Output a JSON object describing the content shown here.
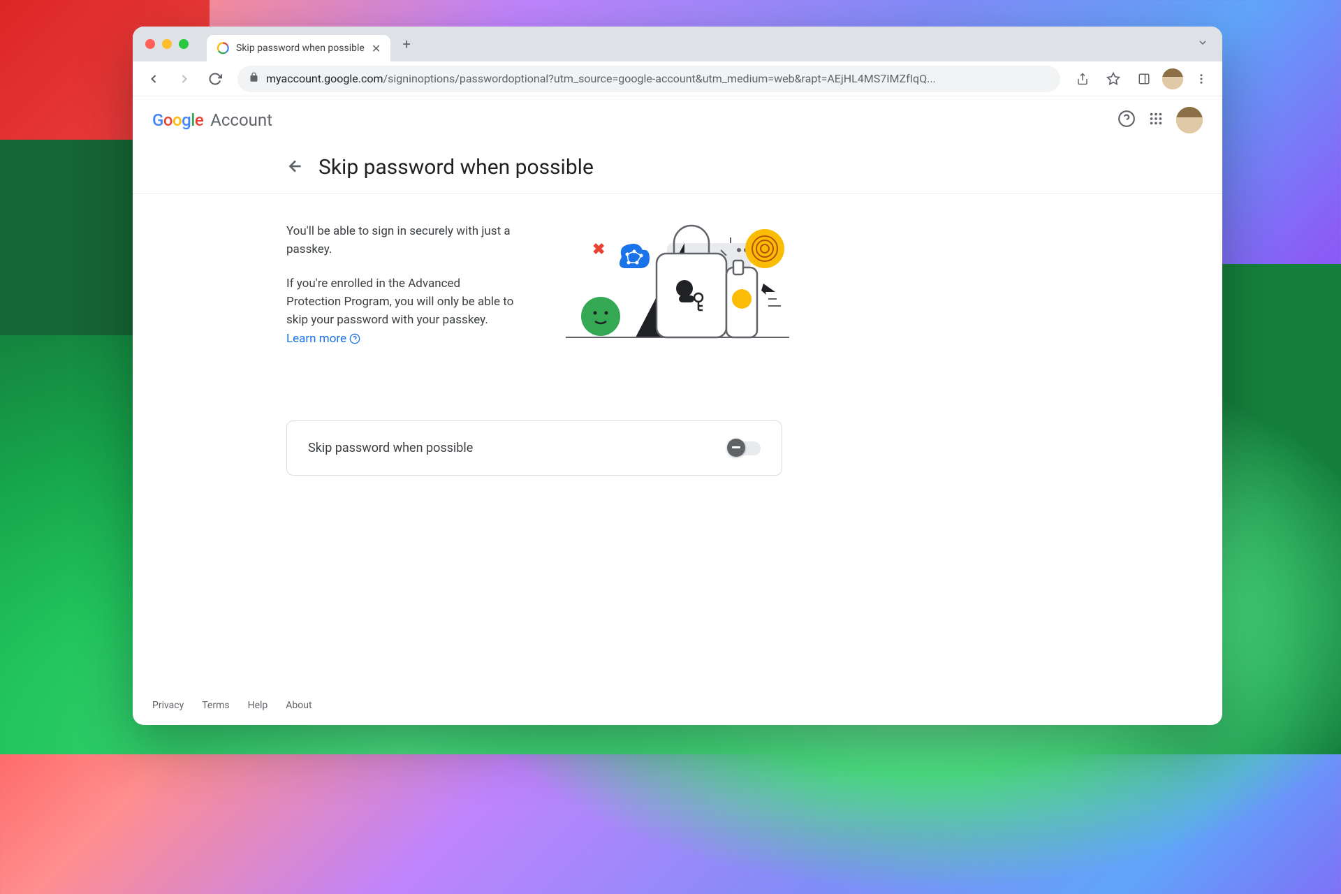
{
  "browser": {
    "tab_title": "Skip password when possible",
    "url_domain": "myaccount.google.com",
    "url_path": "/signinoptions/passwordoptional?utm_source=google-account&utm_medium=web&rapt=AEjHL4MS7IMZfIqQ..."
  },
  "header": {
    "logo_account": "Account"
  },
  "page": {
    "title": "Skip password when possible",
    "para1": "You'll be able to sign in securely with just a passkey.",
    "para2_a": "If you're enrolled in the Advanced Protection Program, you will only be able to skip your password with your passkey. ",
    "learn_more": "Learn more"
  },
  "toggle": {
    "label": "Skip password when possible",
    "state": "off"
  },
  "footer": {
    "privacy": "Privacy",
    "terms": "Terms",
    "help": "Help",
    "about": "About"
  }
}
